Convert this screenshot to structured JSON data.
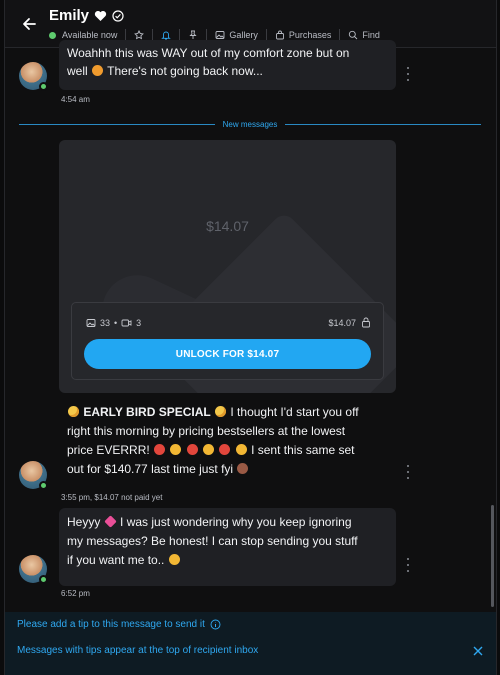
{
  "header": {
    "name": "Emily",
    "status": "Available now",
    "gallery_label": "Gallery",
    "purchases_label": "Purchases",
    "find_label": "Find"
  },
  "messages": [
    {
      "text": "Woahhh this was WAY out of my comfort zone but on",
      "text2": "well",
      "text3": "There's not going back now...",
      "time": "4:54 am"
    }
  ],
  "divider_label": "New messages",
  "paid_post": {
    "price_overlay": "$14.07",
    "media_photos": "33",
    "media_videos": "3",
    "price": "$14.07",
    "unlock_label": "UNLOCK FOR $14.07",
    "text_bold": "EARLY BIRD SPECIAL",
    "text_1": "I thought I'd start you off",
    "text_2": "right this morning by pricing bestsellers at the lowest",
    "text_3a": "price EVERRR!",
    "text_3b": "I sent this same set",
    "text_4a": "out for $140.77 last time just fyi",
    "time": "3:55 pm,",
    "paid_status": "$14.07 not paid yet"
  },
  "last_message": {
    "line1a": "Heyyy",
    "line1b": "I was just wondering why you keep ignoring",
    "line2": "my messages? Be honest! I can stop sending you stuff",
    "line3": "if you want me to..",
    "time": "6:52 pm"
  },
  "tip_notice": {
    "line1": "Please add a tip to this message to send it",
    "line2": "Messages with tips appear at the top of recipient inbox"
  },
  "colors": {
    "accent": "#2fa8f0",
    "button": "#22a7f2",
    "online": "#5ecb6e",
    "bubble": "#1f2024"
  }
}
